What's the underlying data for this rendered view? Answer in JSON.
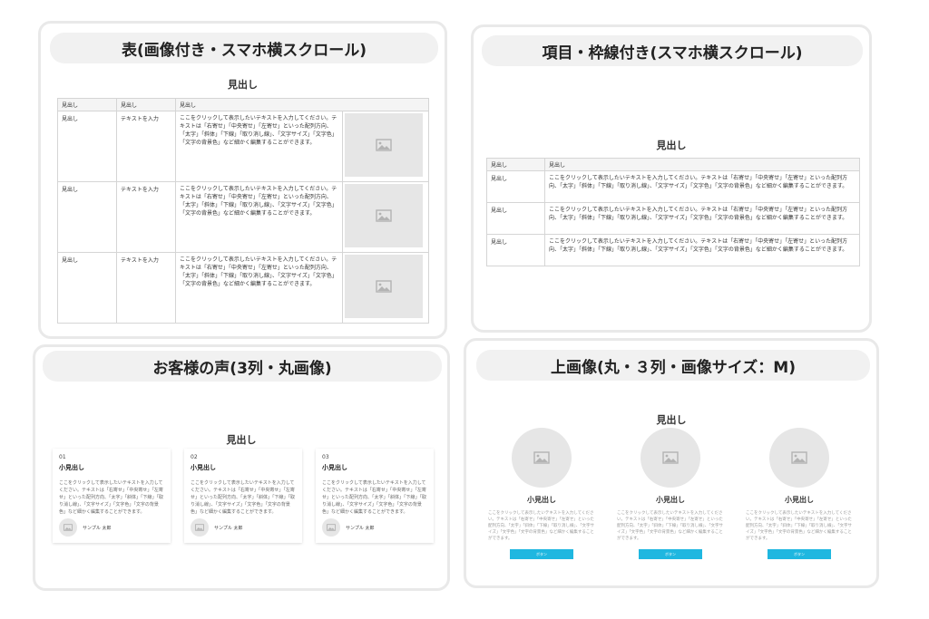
{
  "panel1": {
    "title": "表(画像付き・スマホ横スクロール)",
    "heading": "見出し",
    "headers": [
      "見出し",
      "見出し",
      "見出し"
    ],
    "rows": [
      {
        "c1": "見出し",
        "c2": "テキストを入力",
        "desc": "ここをクリックして表示したいテキストを入力してください。テキストは「右寄せ」「中央寄せ」「左寄せ」といった配列方向、「太字」「斜体」「下線」「取り消し線」、「文字サイズ」「文字色」「文字の背景色」など細かく編集することができます。"
      },
      {
        "c1": "見出し",
        "c2": "テキストを入力",
        "desc": "ここをクリックして表示したいテキストを入力してください。テキストは「右寄せ」「中央寄せ」「左寄せ」といった配列方向、「太字」「斜体」「下線」「取り消し線」、「文字サイズ」「文字色」「文字の背景色」など細かく編集することができます。"
      },
      {
        "c1": "見出し",
        "c2": "テキストを入力",
        "desc": "ここをクリックして表示したいテキストを入力してください。テキストは「右寄せ」「中央寄せ」「左寄せ」といった配列方向、「太字」「斜体」「下線」「取り消し線」、「文字サイズ」「文字色」「文字の背景色」など細かく編集することができます。"
      }
    ]
  },
  "panel2": {
    "title": "項目・枠線付き(スマホ横スクロール)",
    "heading": "見出し",
    "headers": [
      "見出し",
      "見出し"
    ],
    "rows": [
      {
        "c1": "見出し",
        "desc": "ここをクリックして表示したいテキストを入力してください。テキストは「右寄せ」「中央寄せ」「左寄せ」といった配列方向、「太字」「斜体」「下線」「取り消し線」、「文字サイズ」「文字色」「文字の背景色」など細かく編集することができます。"
      },
      {
        "c1": "見出し",
        "desc": "ここをクリックして表示したいテキストを入力してください。テキストは「右寄せ」「中央寄せ」「左寄せ」といった配列方向、「太字」「斜体」「下線」「取り消し線」、「文字サイズ」「文字色」「文字の背景色」など細かく編集することができます。"
      },
      {
        "c1": "見出し",
        "desc": "ここをクリックして表示したいテキストを入力してください。テキストは「右寄せ」「中央寄せ」「左寄せ」といった配列方向、「太字」「斜体」「下線」「取り消し線」、「文字サイズ」「文字色」「文字の背景色」など細かく編集することができます。"
      }
    ]
  },
  "panel3": {
    "title": "お客様の声(3列・丸画像)",
    "heading": "見出し",
    "cards": [
      {
        "num": "01",
        "sub": "小見出し",
        "body": "ここをクリックして表示したいテキストを入力してください。テキストは「右寄せ」「中央寄せ」「左寄せ」といった配列方向、「太字」「斜体」「下線」「取り消し線」、「文字サイズ」「文字色」「文字の背景色」など細かく編集することができます。",
        "author": "サンプル 太郎"
      },
      {
        "num": "02",
        "sub": "小見出し",
        "body": "ここをクリックして表示したいテキストを入力してください。テキストは「右寄せ」「中央寄せ」「左寄せ」といった配列方向、「太字」「斜体」「下線」「取り消し線」、「文字サイズ」「文字色」「文字の背景色」など細かく編集することができます。",
        "author": "サンプル 太郎"
      },
      {
        "num": "03",
        "sub": "小見出し",
        "body": "ここをクリックして表示したいテキストを入力してください。テキストは「右寄せ」「中央寄せ」「左寄せ」といった配列方向、「太字」「斜体」「下線」「取り消し線」、「文字サイズ」「文字色」「文字の背景色」など細かく編集することができます。",
        "author": "サンプル 太郎"
      }
    ]
  },
  "panel4": {
    "title": "上画像(丸・３列・画像サイズ：M)",
    "heading": "見出し",
    "columns": [
      {
        "sub": "小見出し",
        "body": "ここをクリックして表示したいテキストを入力してください。テキストは「右寄せ」「中央寄せ」「左寄せ」といった配列方向、「太字」「斜体」「下線」「取り消し線」、「文字サイズ」「文字色」「文字の背景色」など細かく編集することができます。",
        "button": "ボタン"
      },
      {
        "sub": "小見出し",
        "body": "ここをクリックして表示したいテキストを入力してください。テキストは「右寄せ」「中央寄せ」「左寄せ」といった配列方向、「太字」「斜体」「下線」「取り消し線」、「文字サイズ」「文字色」「文字の背景色」など細かく編集することができます。",
        "button": "ボタン"
      },
      {
        "sub": "小見出し",
        "body": "ここをクリックして表示したいテキストを入力してください。テキストは「右寄せ」「中央寄せ」「左寄せ」といった配列方向、「太字」「斜体」「下線」「取り消し線」、「文字サイズ」「文字色」「文字の背景色」など細かく編集することができます。",
        "button": "ボタン"
      }
    ],
    "button_color": "#1fb7e0"
  },
  "icons": {
    "image_placeholder": "image-icon"
  }
}
